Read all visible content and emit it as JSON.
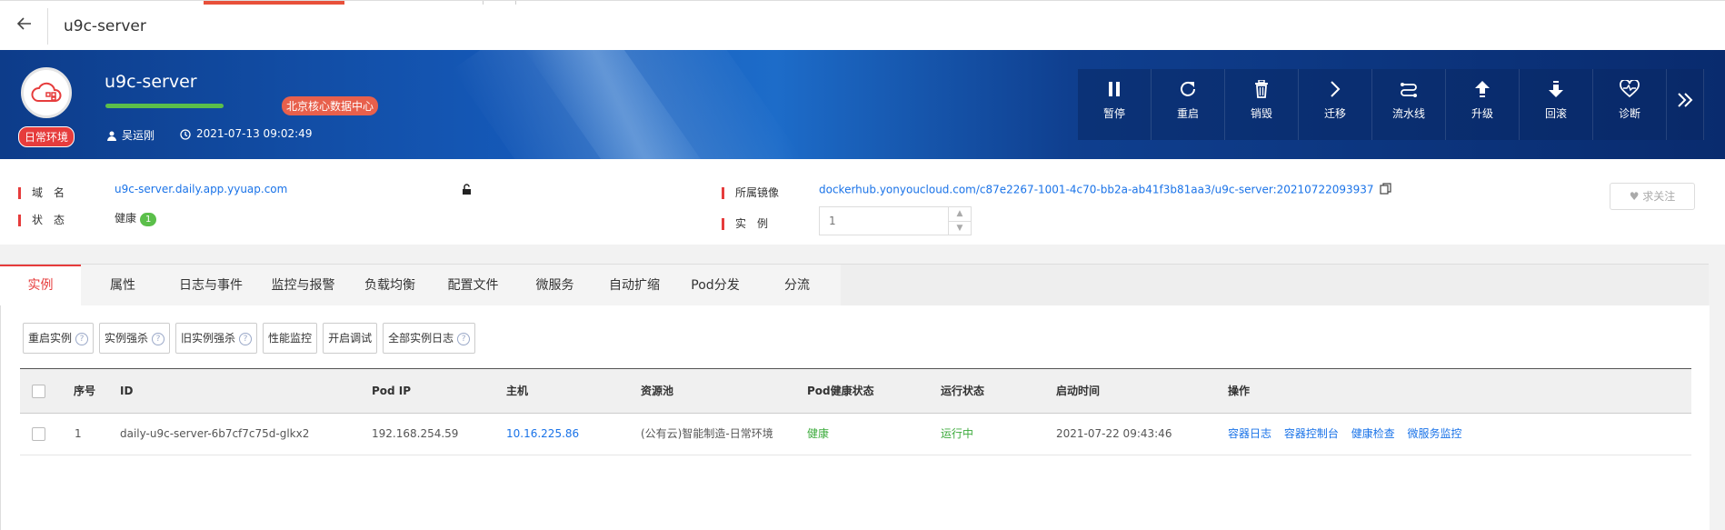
{
  "header": {
    "title": "u9c-server"
  },
  "banner": {
    "app_name": "u9c-server",
    "env_badge": "日常环境",
    "datacenter_badge": "北京核心数据中心",
    "owner": "吴运刚",
    "created_at": "2021-07-13 09:02:49"
  },
  "actions": [
    {
      "label": "暂停",
      "icon": "pause-icon"
    },
    {
      "label": "重启",
      "icon": "restart-icon"
    },
    {
      "label": "销毁",
      "icon": "trash-icon"
    },
    {
      "label": "迁移",
      "icon": "chevron-right-icon"
    },
    {
      "label": "流水线",
      "icon": "pipeline-icon"
    },
    {
      "label": "升级",
      "icon": "upgrade-icon"
    },
    {
      "label": "回滚",
      "icon": "rollback-icon"
    },
    {
      "label": "诊断",
      "icon": "heart-pulse-icon"
    }
  ],
  "info": {
    "domain_label": "域　名",
    "domain_value": "u9c-server.daily.app.yyuap.com",
    "status_label": "状　态",
    "status_value": "健康",
    "status_count": "1",
    "image_label": "所属镜像",
    "image_value": "dockerhub.yonyoucloud.com/c87e2267-1001-4c70-bb2a-ab41f3b81aa3/u9c-server:20210722093937",
    "instance_label": "实　例",
    "instance_placeholder": "1",
    "follow_label": "求关注"
  },
  "tabs": [
    "实例",
    "属性",
    "日志与事件",
    "监控与报警",
    "负载均衡",
    "配置文件",
    "微服务",
    "自动扩缩",
    "Pod分发",
    "分流"
  ],
  "toolbar": [
    {
      "label": "重启实例",
      "help": true
    },
    {
      "label": "实例强杀",
      "help": true
    },
    {
      "label": "旧实例强杀",
      "help": true
    },
    {
      "label": "性能监控",
      "help": false
    },
    {
      "label": "开启调试",
      "help": false
    },
    {
      "label": "全部实例日志",
      "help": true
    }
  ],
  "table": {
    "headers": [
      "序号",
      "ID",
      "Pod IP",
      "主机",
      "资源池",
      "Pod健康状态",
      "运行状态",
      "启动时间",
      "操作"
    ],
    "rows": [
      {
        "index": "1",
        "id": "daily-u9c-server-6b7cf7c75d-glkx2",
        "pod_ip": "192.168.254.59",
        "host": "10.16.225.86",
        "pool": "(公有云)智能制造-日常环境",
        "health": "健康",
        "run_status": "运行中",
        "start_time": "2021-07-22 09:43:46",
        "ops": [
          "容器日志",
          "容器控制台",
          "健康检查",
          "微服务监控"
        ]
      }
    ]
  },
  "colors": {
    "accent": "#e63c3c",
    "link": "#1a73e8",
    "healthy": "#3cab3c"
  }
}
